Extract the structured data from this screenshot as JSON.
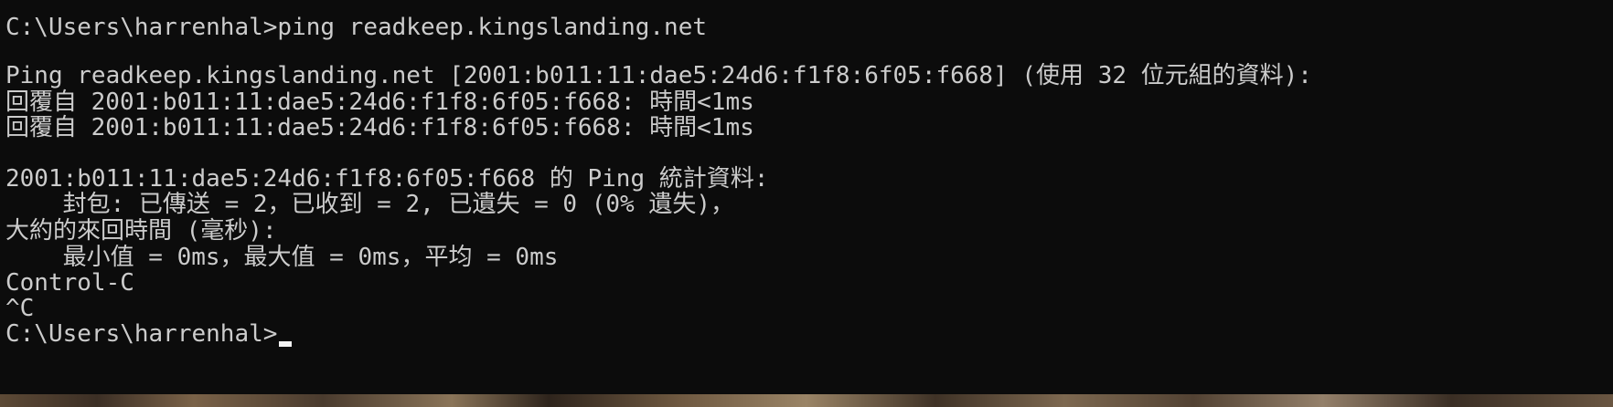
{
  "terminal": {
    "lines": [
      "C:\\Users\\harrenhal>ping readkeep.kingslanding.net",
      "",
      "Ping readkeep.kingslanding.net [2001:b011:11:dae5:24d6:f1f8:6f05:f668] (使用 32 位元組的資料):",
      "回覆自 2001:b011:11:dae5:24d6:f1f8:6f05:f668: 時間<1ms",
      "回覆自 2001:b011:11:dae5:24d6:f1f8:6f05:f668: 時間<1ms",
      "",
      "2001:b011:11:dae5:24d6:f1f8:6f05:f668 的 Ping 統計資料:",
      "    封包: 已傳送 = 2，已收到 = 2, 已遺失 = 0 (0% 遺失)，",
      "大約的來回時間 (毫秒):",
      "    最小值 = 0ms，最大值 = 0ms，平均 = 0ms",
      "Control-C",
      "^C"
    ],
    "prompt": "C:\\Users\\harrenhal>"
  },
  "colors": {
    "background": "#0c0c0c",
    "foreground": "#cccccc",
    "cursor": "#f2f2f2"
  }
}
